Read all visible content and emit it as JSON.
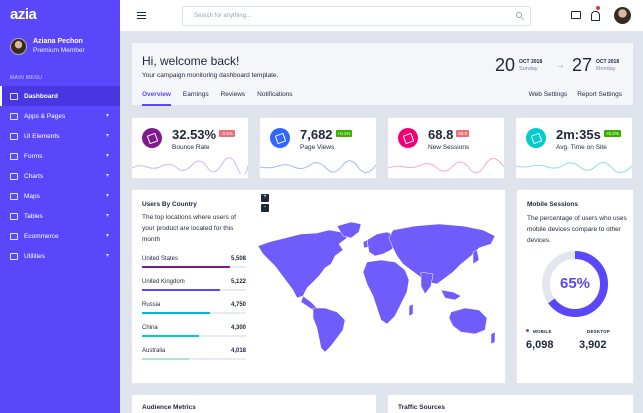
{
  "sidebar": {
    "logo": "azia",
    "profile": {
      "name": "Aziana Pechon",
      "role": "Premium Member"
    },
    "menu_label": "MAIN MENU",
    "items": [
      {
        "label": "Dashboard",
        "icon": "dashboard-icon",
        "active": true,
        "has_children": false
      },
      {
        "label": "Apps & Pages",
        "icon": "apps-icon",
        "active": false,
        "has_children": true
      },
      {
        "label": "UI Elements",
        "icon": "ui-elements-icon",
        "active": false,
        "has_children": true
      },
      {
        "label": "Forms",
        "icon": "forms-icon",
        "active": false,
        "has_children": true
      },
      {
        "label": "Charts",
        "icon": "charts-icon",
        "active": false,
        "has_children": true
      },
      {
        "label": "Maps",
        "icon": "maps-icon",
        "active": false,
        "has_children": true
      },
      {
        "label": "Tables",
        "icon": "tables-icon",
        "active": false,
        "has_children": true
      },
      {
        "label": "Ecommerce",
        "icon": "ecommerce-icon",
        "active": false,
        "has_children": true
      },
      {
        "label": "Utilities",
        "icon": "utilities-icon",
        "active": false,
        "has_children": true
      }
    ]
  },
  "header": {
    "search_placeholder": "Search for anything...",
    "icons": [
      "menu-icon",
      "search-icon",
      "chat-icon",
      "bell-icon"
    ]
  },
  "welcome": {
    "title": "Hi, welcome back!",
    "subtitle": "Your campaign monitoring dashboard template.",
    "date_from": {
      "day": "20",
      "month_year": "OCT 2018",
      "weekday": "Sunday"
    },
    "date_to": {
      "day": "27",
      "month_year": "OCT 2018",
      "weekday": "Monday"
    },
    "tabs": [
      "Overview",
      "Earnings",
      "Reviews",
      "Notifications"
    ],
    "links": [
      "Web Settings",
      "Report Settings"
    ]
  },
  "stats": [
    {
      "value": "32.53%",
      "badge": "-0.5%",
      "badge_color": "#f16d75",
      "label": "Bounce Rate",
      "icon_color": "#7f1a8c",
      "line_color": "#d4b5f5"
    },
    {
      "value": "7,682",
      "badge": "+0.1%",
      "badge_color": "#3bb001",
      "label": "Page Views",
      "icon_color": "#3366ff",
      "line_color": "#9fb8ff"
    },
    {
      "value": "68.8",
      "badge": "68.8",
      "badge_color": "#f16d75",
      "label": "New Sessions",
      "icon_color": "#f10075",
      "line_color": "#ffa6cf"
    },
    {
      "value": "2m:35s",
      "badge": "+0.2%",
      "badge_color": "#3bb001",
      "label": "Avg. Time on Site",
      "icon_color": "#00cccc",
      "line_color": "#8de0e0"
    }
  ],
  "users_by_country": {
    "title": "Users By Country",
    "description": "The top locations where users of your product are located for this month",
    "countries": [
      {
        "name": "United States",
        "value": "5,508",
        "progress": 0.85,
        "color": "#7f1a8c"
      },
      {
        "name": "United Kingdom",
        "value": "5,122",
        "progress": 0.75,
        "color": "#5b47fb"
      },
      {
        "name": "Russia",
        "value": "4,750",
        "progress": 0.65,
        "color": "#00b8d4"
      },
      {
        "name": "China",
        "value": "4,300",
        "progress": 0.55,
        "color": "#00cccc"
      },
      {
        "name": "Australia",
        "value": "4,018",
        "progress": 0.45,
        "color": "#a8e6cf"
      }
    ],
    "zoom_in": "+",
    "zoom_out": "-",
    "map_color": "#6f5cfb"
  },
  "mobile_sessions": {
    "title": "Mobile Sessions",
    "description": "The percentage of users who uses mobile devices compare to other devices.",
    "percent_label": "65%",
    "percent": 65,
    "mobile_label": "MOBILE",
    "mobile_value": "6,098",
    "desktop_label": "DESKTOP",
    "desktop_value": "3,902"
  },
  "bottom": {
    "audience_title": "Audience Metrics",
    "traffic_title": "Traffic Sources"
  }
}
